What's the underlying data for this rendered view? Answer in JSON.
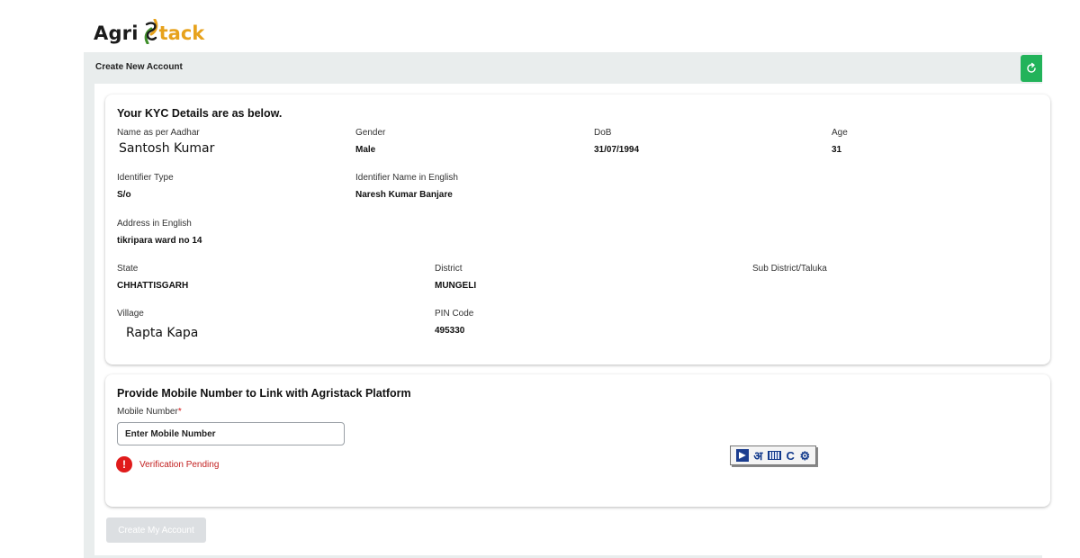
{
  "brand": {
    "part1": "Agri",
    "part2": "tack",
    "accent_color": "#e7a21c",
    "leaf_color": "#3f8f2b"
  },
  "header": {
    "title": "Create New Account",
    "refresh_icon": "refresh-icon",
    "refresh_color": "#22b35a"
  },
  "kyc": {
    "title": "Your KYC Details are as below.",
    "name_label": "Name as per Aadhar",
    "name_value": "Santosh Kumar",
    "gender_label": "Gender",
    "gender_value": "Male",
    "dob_label": "DoB",
    "dob_value": "31/07/1994",
    "age_label": "Age",
    "age_value": "31",
    "identifier_type_label": "Identifier Type",
    "identifier_type_value": "S/o",
    "identifier_name_label": "Identifier Name in English",
    "identifier_name_value": "Naresh Kumar Banjare",
    "address_label": "Address in English",
    "address_value": "tikripara ward no 14",
    "state_label": "State",
    "state_value": "CHHATTISGARH",
    "district_label": "District",
    "district_value": "MUNGELI",
    "subdistrict_label": "Sub District/Taluka",
    "subdistrict_value": "",
    "village_label": "Village",
    "village_value": "Rapta Kapa",
    "pin_label": "PIN Code",
    "pin_value": "495330"
  },
  "mobile": {
    "title": "Provide Mobile Number to Link with Agristack Platform",
    "field_label": "Mobile Number",
    "required_mark": "*",
    "placeholder": "Enter Mobile Number",
    "status_icon": "!",
    "status_text": "Verification Pending",
    "status_color": "#e01b1b"
  },
  "input_toolbar": {
    "hindi_glyph": "अ",
    "c_glyph": "C",
    "icons": [
      "app-logo-icon",
      "keyboard-icon",
      "gear-icon"
    ]
  },
  "actions": {
    "create_label": "Create My Account"
  }
}
